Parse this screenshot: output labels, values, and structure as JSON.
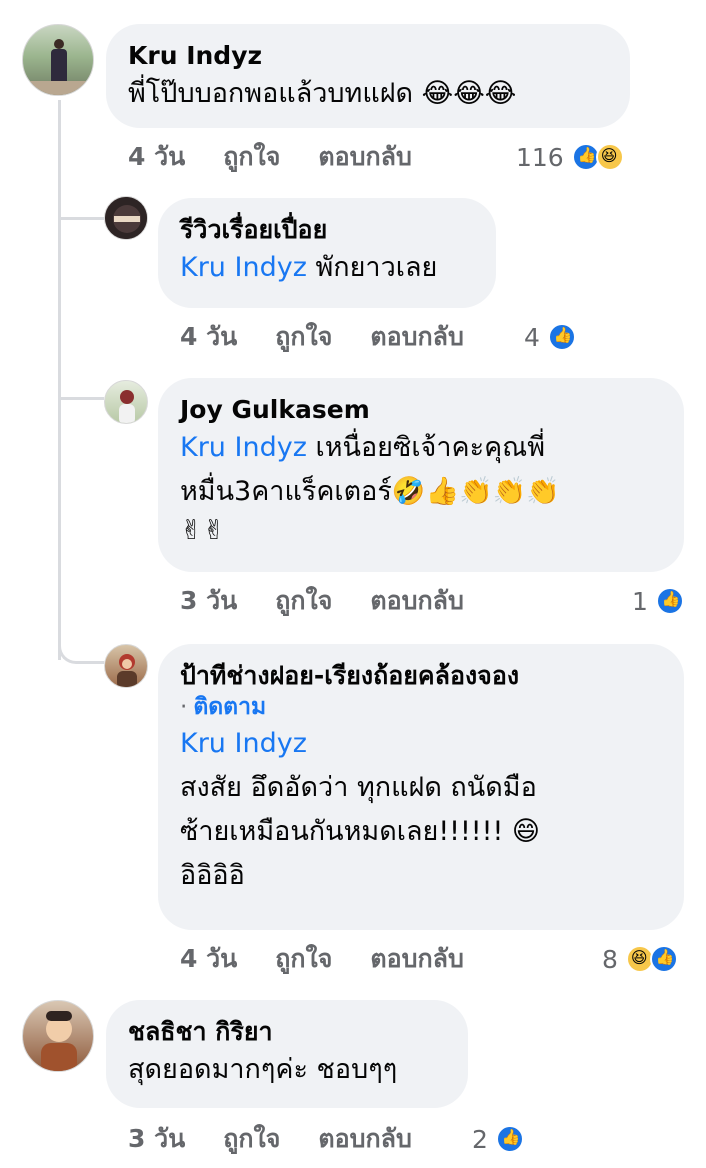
{
  "comments": [
    {
      "author": "Kru Indyz",
      "text": "พี่โป๊บบอกพอแล้วบทแฝด 😂😂😂",
      "time": "4 วัน",
      "like_label": "ถูกใจ",
      "reply_label": "ตอบกลับ",
      "reaction_count": "116",
      "reaction_icons": [
        "like-icon",
        "haha-icon"
      ]
    },
    {
      "author": "รีวิวเรื่อยเปื่อย",
      "mention": "Kru Indyz",
      "text": "พักยาวเลย",
      "time": "4 วัน",
      "like_label": "ถูกใจ",
      "reply_label": "ตอบกลับ",
      "reaction_count": "4",
      "reaction_icons": [
        "like-icon"
      ]
    },
    {
      "author": "Joy Gulkasem",
      "mention": "Kru Indyz",
      "text_line1": "เหนื่อยซิเจ้าคะคุณพี่",
      "text_line2": "หมื่น3คาแร็คเตอร์🤣👍👏👏👏",
      "text_line3": "✌✌",
      "time": "3 วัน",
      "like_label": "ถูกใจ",
      "reply_label": "ตอบกลับ",
      "reaction_count": "1",
      "reaction_icons": [
        "like-icon"
      ]
    },
    {
      "author": "ป้าทีช่างฝอย-เรียงถ้อยคล้องจอง",
      "follow_label": "ติดตาม",
      "mention": "Kru Indyz",
      "text_line1": "สงสัย อึดอัดว่า ทุกแฝด ถนัดมือ",
      "text_line2": "ซ้ายเหมือนกันหมดเลย!!!!!! 😄",
      "text_line3": "อิอิอิอิ",
      "time": "4 วัน",
      "like_label": "ถูกใจ",
      "reply_label": "ตอบกลับ",
      "reaction_count": "8",
      "reaction_icons": [
        "haha-icon",
        "like-icon"
      ]
    },
    {
      "author": "ชลธิชา กิริยา",
      "text": "สุดยอดมากๆค่ะ ชอบๆๆ",
      "time": "3 วัน",
      "like_label": "ถูกใจ",
      "reply_label": "ตอบกลับ",
      "reaction_count": "2",
      "reaction_icons": [
        "like-icon"
      ]
    }
  ],
  "colors": {
    "bubble": "#f0f2f5",
    "link": "#1877f2",
    "meta": "#65676b",
    "like": "#1b74e4",
    "haha": "#f7c74a"
  }
}
